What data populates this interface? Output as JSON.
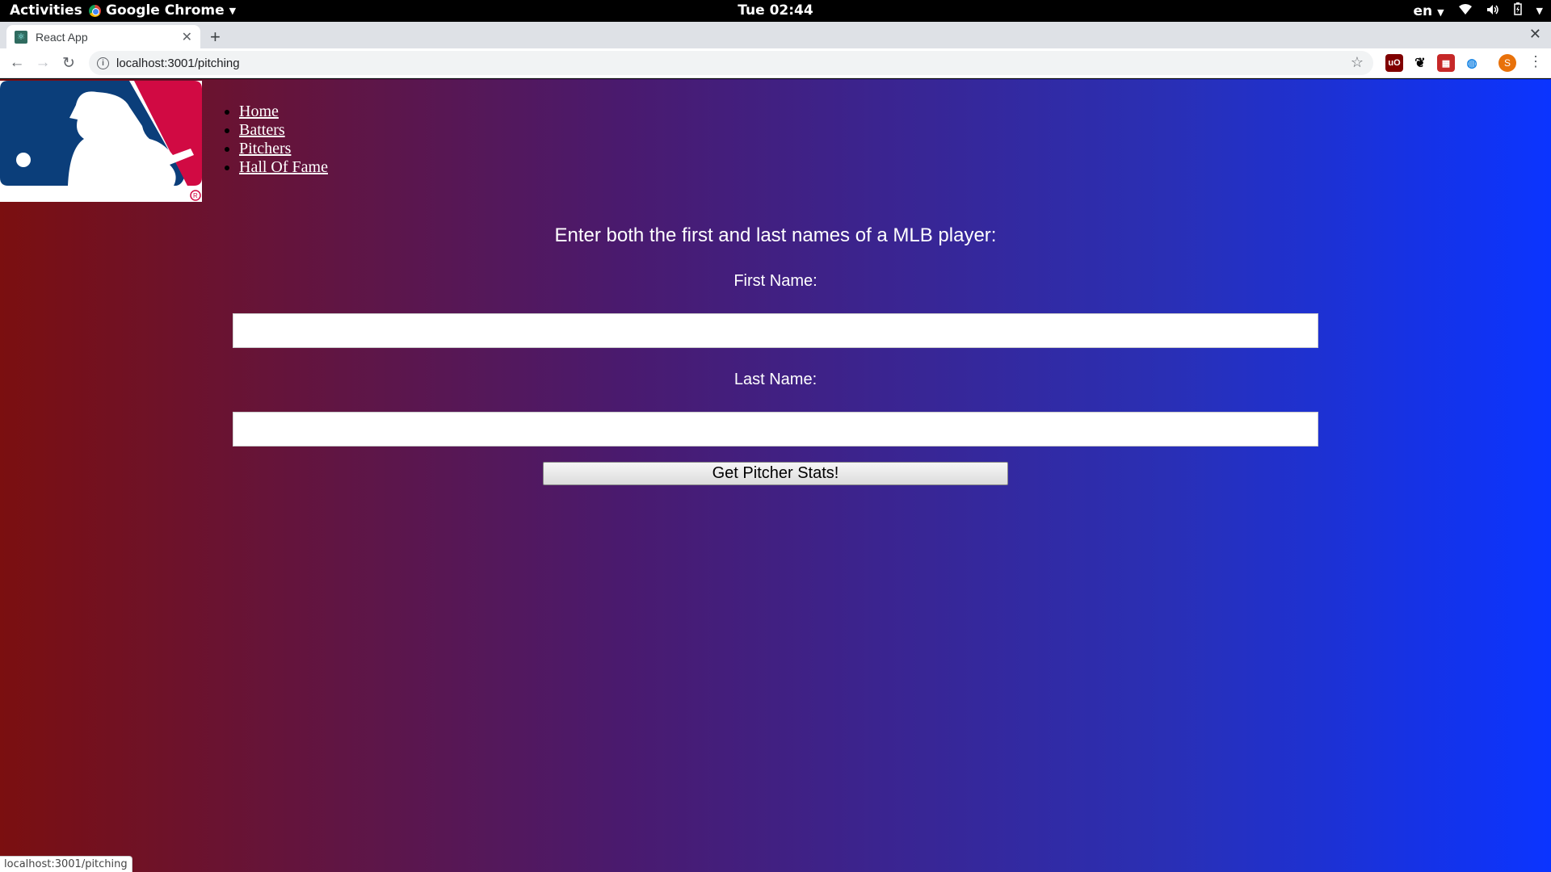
{
  "system_bar": {
    "activities": "Activities",
    "app_name": "Google Chrome",
    "clock": "Tue 02:44",
    "language": "en"
  },
  "browser": {
    "tab_title": "React App",
    "url": "localhost:3001/pitching",
    "status_url": "localhost:3001/pitching",
    "profile_initial": "S"
  },
  "nav": {
    "items": [
      {
        "label": "Home"
      },
      {
        "label": "Batters"
      },
      {
        "label": "Pitchers"
      },
      {
        "label": "Hall Of Fame"
      }
    ]
  },
  "form": {
    "heading": "Enter both the first and last names of a MLB player:",
    "first_label": "First Name:",
    "first_value": "",
    "last_label": "Last Name:",
    "last_value": "",
    "submit_label": "Get Pitcher Stats!"
  },
  "colors": {
    "logo_blue": "#0b3e7a",
    "logo_red": "#d10a43",
    "gradient_left": "#7b0f10",
    "gradient_right": "#0b34ff"
  }
}
